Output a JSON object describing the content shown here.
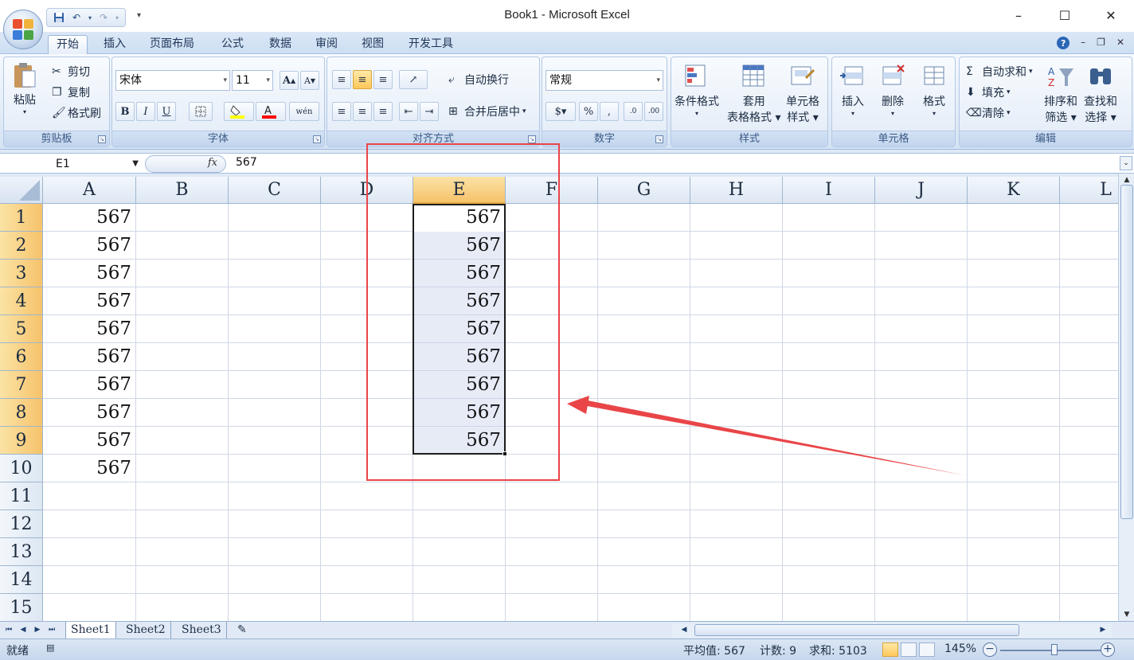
{
  "window": {
    "title": "Book1 - Microsoft Excel",
    "controls": [
      "–",
      "☐",
      "✕"
    ]
  },
  "qat": {
    "save": "save-icon",
    "undo": "undo-icon",
    "redo": "redo-icon",
    "more": "▾"
  },
  "tabs": [
    {
      "label": "开始",
      "active": true
    },
    {
      "label": "插入"
    },
    {
      "label": "页面布局"
    },
    {
      "label": "公式"
    },
    {
      "label": "数据"
    },
    {
      "label": "审阅"
    },
    {
      "label": "视图"
    },
    {
      "label": "开发工具"
    }
  ],
  "ribbon": {
    "clipboard": {
      "label": "剪贴板",
      "paste": "粘贴",
      "cut": "剪切",
      "copy": "复制",
      "format_painter": "格式刷"
    },
    "font": {
      "label": "字体",
      "name": "宋体",
      "size": "11",
      "grow": "A",
      "shrink": "A",
      "bold": "B",
      "italic": "I",
      "underline": "U",
      "phonetic": "wén"
    },
    "alignment": {
      "label": "对齐方式",
      "wrap": "自动换行",
      "merge": "合并后居中"
    },
    "number": {
      "label": "数字",
      "format": "常规",
      "percent": "%",
      "comma": ","
    },
    "styles": {
      "label": "样式",
      "conditional": "条件格式",
      "table_fmt_1": "套用",
      "table_fmt_2": "表格格式",
      "cell_style_1": "单元格",
      "cell_style_2": "样式"
    },
    "cells": {
      "label": "单元格",
      "insert": "插入",
      "delete": "删除",
      "format": "格式"
    },
    "editing": {
      "label": "编辑",
      "autosum": "自动求和",
      "fill": "填充",
      "clear": "清除",
      "sort_1": "排序和",
      "sort_2": "筛选",
      "find_1": "查找和",
      "find_2": "选择"
    }
  },
  "formula_bar": {
    "name_box": "E1",
    "fx": "fx",
    "value": "567"
  },
  "sheet": {
    "columns": [
      "A",
      "B",
      "C",
      "D",
      "E",
      "F",
      "G",
      "H",
      "I",
      "J",
      "K",
      "L"
    ],
    "selected_column": "E",
    "rows": [
      "1",
      "2",
      "3",
      "4",
      "5",
      "6",
      "7",
      "8",
      "9",
      "10",
      "11",
      "12",
      "13",
      "14",
      "15"
    ],
    "selected_rows": [
      "1",
      "2",
      "3",
      "4",
      "5",
      "6",
      "7",
      "8",
      "9"
    ],
    "col_a": [
      "567",
      "567",
      "567",
      "567",
      "567",
      "567",
      "567",
      "567",
      "567",
      "567"
    ],
    "col_e": [
      "567",
      "567",
      "567",
      "567",
      "567",
      "567",
      "567",
      "567",
      "567"
    ]
  },
  "sheet_tabs": [
    {
      "label": "Sheet1",
      "active": true
    },
    {
      "label": "Sheet2"
    },
    {
      "label": "Sheet3"
    }
  ],
  "status": {
    "ready": "就绪",
    "average": "平均值: 567",
    "count": "计数: 9",
    "sum": "求和: 5103",
    "zoom": "145%"
  },
  "annotation_color": "#e94548",
  "selection_color": "#f6c36b"
}
